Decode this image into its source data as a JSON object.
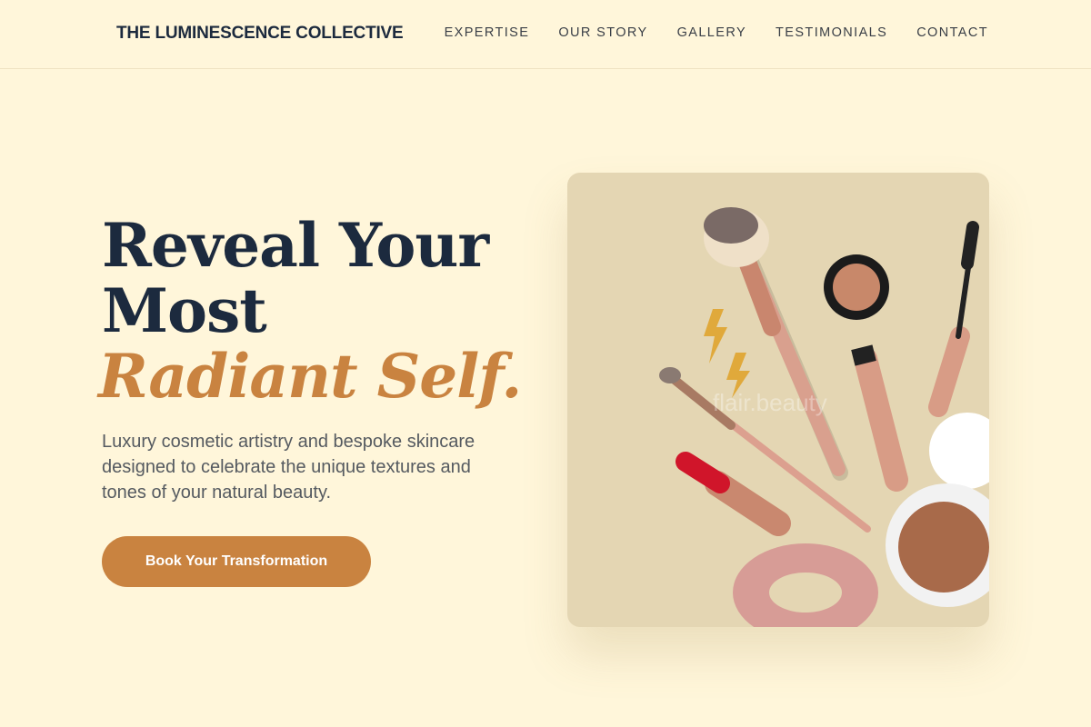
{
  "header": {
    "brand": "THE LUMINESCENCE COLLECTIVE",
    "nav": [
      "EXPERTISE",
      "OUR STORY",
      "GALLERY",
      "TESTIMONIALS",
      "CONTACT"
    ]
  },
  "hero": {
    "headline_line1": "Reveal Your",
    "headline_line2": "Most",
    "headline_accent": "Radiant Self.",
    "subtitle": "Luxury cosmetic artistry and bespoke skincare designed to celebrate the unique textures and tones of your natural beauty.",
    "cta_label": "Book Your Transformation"
  },
  "image": {
    "alt": "Flat lay of makeup brushes, lipstick, mascara and compacts",
    "watermark": "flair.beauty"
  },
  "colors": {
    "background": "#fff6da",
    "accent": "#c98340",
    "heading": "#1c2a3e",
    "image_bg": "#e4d6b3"
  }
}
